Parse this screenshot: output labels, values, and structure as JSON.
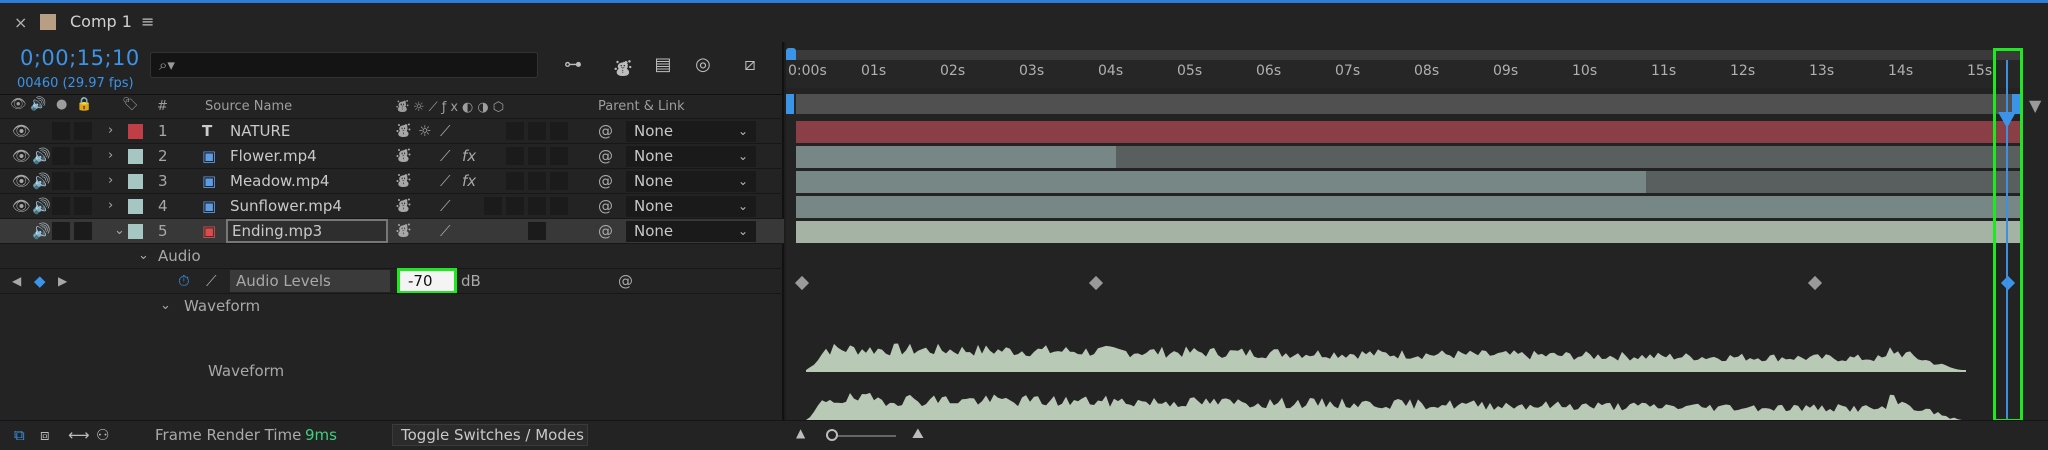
{
  "tab": {
    "close": "×",
    "title": "Comp 1",
    "menu": "≡"
  },
  "composition": {
    "timecode": "0;00;15;10",
    "frame_info": "00460 (29.97 fps)"
  },
  "search": {
    "icon": "search-icon",
    "placeholder": ""
  },
  "headers": {
    "num": "#",
    "source_name": "Source Name",
    "parent_link": "Parent & Link"
  },
  "layers": [
    {
      "num": "1",
      "name": "NATURE",
      "type": "T",
      "label_color": "#c23e47",
      "parent": "None",
      "fx": ""
    },
    {
      "num": "2",
      "name": "Flower.mp4",
      "type": "video",
      "label_color": "#a6c6c3",
      "parent": "None",
      "fx": "fx"
    },
    {
      "num": "3",
      "name": "Meadow.mp4",
      "type": "video",
      "label_color": "#a6c6c3",
      "parent": "None",
      "fx": "fx"
    },
    {
      "num": "4",
      "name": "Sunflower.mp4",
      "type": "video",
      "label_color": "#a6c6c3",
      "parent": "None",
      "fx": ""
    },
    {
      "num": "5",
      "name": "Ending.mp3",
      "type": "audio",
      "label_color": "#a6c6c3",
      "parent": "None",
      "fx": ""
    }
  ],
  "audio_group": {
    "label": "Audio",
    "property": "Audio Levels",
    "value": "-70",
    "unit": "dB"
  },
  "waveform_group": {
    "label": "Waveform",
    "row_label": "Waveform"
  },
  "ruler_ticks": [
    "0:00s",
    "01s",
    "02s",
    "03s",
    "04s",
    "05s",
    "06s",
    "07s",
    "08s",
    "09s",
    "10s",
    "11s",
    "12s",
    "13s",
    "14s",
    "15s"
  ],
  "footer": {
    "frame_render_label": "Frame Render Time",
    "frame_render_value": "9ms",
    "toggle_label": "Toggle Switches / Modes"
  },
  "colors": {
    "accent": "#3b94e8",
    "highlight": "#1ee81e",
    "text_layer_bar": "#8a3e45",
    "video_bar": "#778785",
    "audio_bar": "#a4b3a3",
    "render_time": "#3fd07f"
  }
}
